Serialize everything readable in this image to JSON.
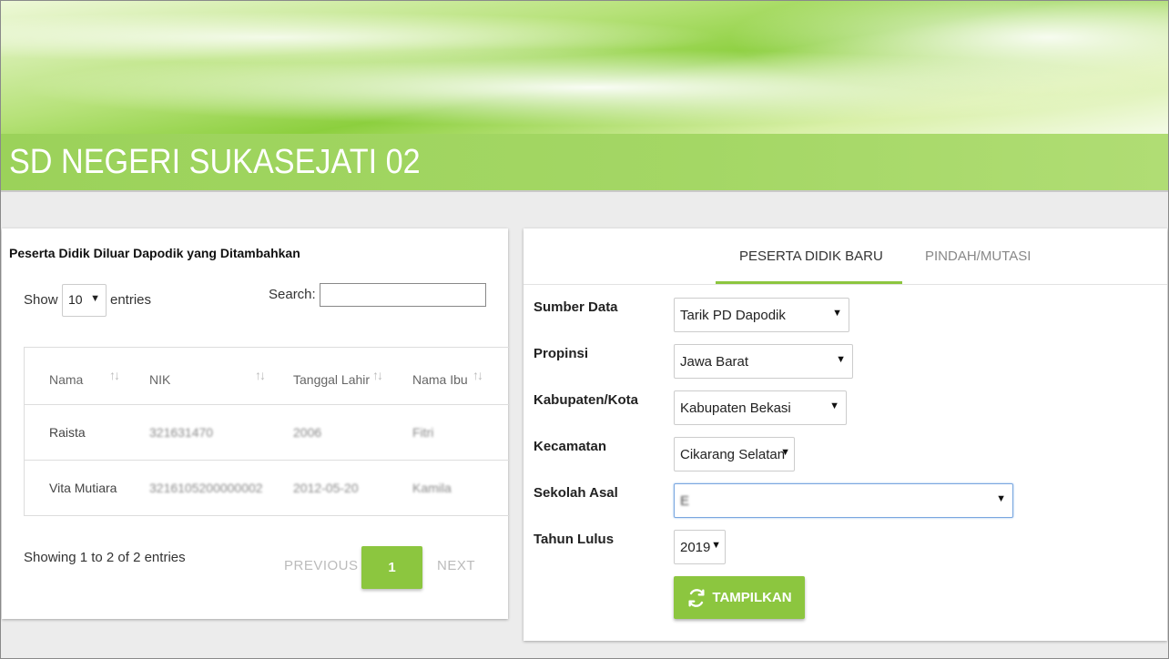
{
  "header": {
    "site_title": "SD NEGERI SUKASEJATI 02"
  },
  "left_panel": {
    "title": "Peserta Didik Diluar Dapodik yang Ditambahkan",
    "show_label": "Show",
    "page_size": "10",
    "entries_label": "entries",
    "search_label": "Search:",
    "search_value": "",
    "columns": [
      "Nama",
      "NIK",
      "Tanggal Lahir",
      "Nama Ibu"
    ],
    "sort_icon": "sort-both-icon",
    "rows": [
      [
        "Raista",
        "321631470",
        "2006",
        "Fitri"
      ],
      [
        "Vita Mutiara",
        "3216105200000002",
        "2012-05-20",
        "Kamila"
      ]
    ],
    "info": "Showing 1 to 2 of 2 entries",
    "pagination": {
      "previous": "PREVIOUS",
      "current": "1",
      "next": "NEXT"
    }
  },
  "right_panel": {
    "tabs": [
      {
        "label": "PESERTA DIDIK BARU",
        "active": true
      },
      {
        "label": "PINDAH/MUTASI",
        "active": false
      }
    ],
    "fields": {
      "sumber_data": {
        "label": "Sumber Data",
        "value": "Tarik PD Dapodik"
      },
      "propinsi": {
        "label": "Propinsi",
        "value": "Jawa Barat"
      },
      "kabupaten": {
        "label": "Kabupaten/Kota",
        "value": "Kabupaten Bekasi"
      },
      "kecamatan": {
        "label": "Kecamatan",
        "value": "Cikarang Selatan"
      },
      "sekolah_asal": {
        "label": "Sekolah Asal",
        "value": "E"
      },
      "tahun_lulus": {
        "label": "Tahun Lulus",
        "value": "2019"
      }
    },
    "submit_label": "TAMPILKAN",
    "submit_icon": "refresh-icon"
  },
  "colors": {
    "accent": "#8cc63f",
    "header_green": "#a4d765"
  }
}
